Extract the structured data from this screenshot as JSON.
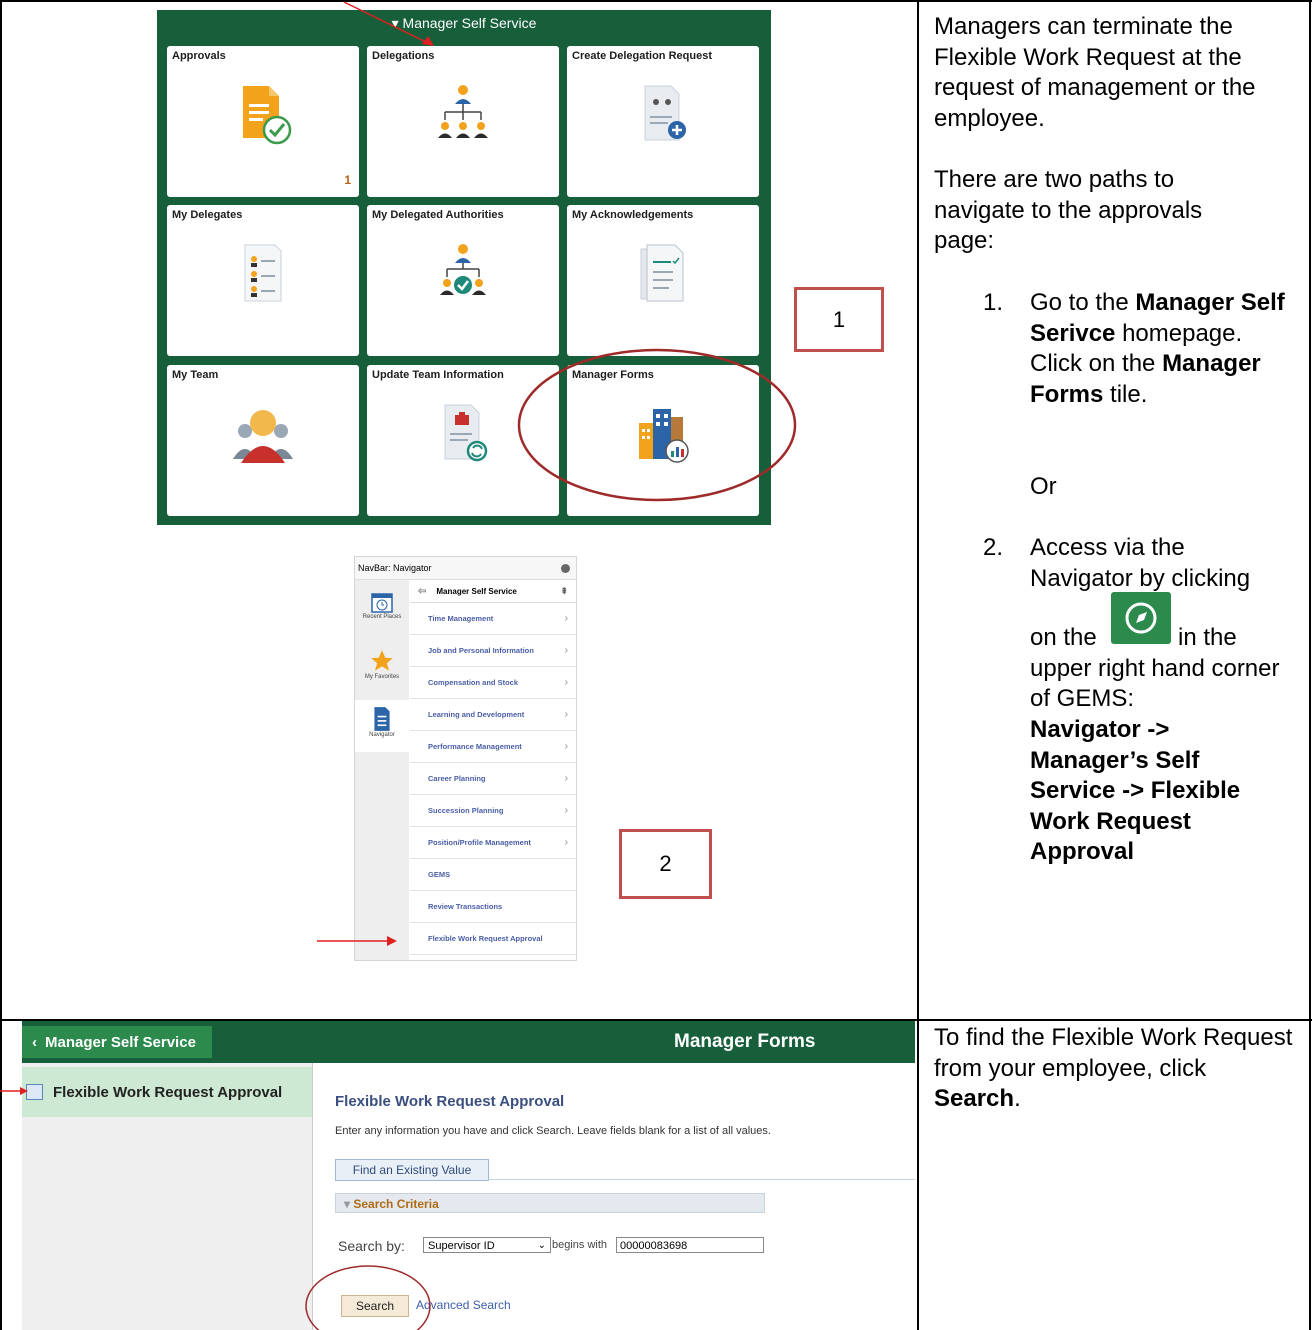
{
  "tiles_section": {
    "header": "▾ Manager Self Service",
    "tiles": [
      {
        "title": "Approvals",
        "icon": "approvals-document-check-icon",
        "count": "1"
      },
      {
        "title": "Delegations",
        "icon": "org-chart-icon"
      },
      {
        "title": "Create Delegation Request",
        "icon": "document-add-user-icon"
      },
      {
        "title": "My Delegates",
        "icon": "delegates-list-icon"
      },
      {
        "title": "My Delegated Authorities",
        "icon": "delegated-authority-check-icon"
      },
      {
        "title": "My Acknowledgements",
        "icon": "acknowledgements-checklist-icon"
      },
      {
        "title": "My Team",
        "icon": "team-person-icon"
      },
      {
        "title": "Update Team Information",
        "icon": "document-briefcase-refresh-icon"
      },
      {
        "title": "Manager Forms",
        "icon": "buildings-chart-icon"
      }
    ]
  },
  "callouts": {
    "one": "1",
    "two": "2"
  },
  "navigator": {
    "header": "NavBar: Navigator",
    "side": [
      {
        "label": "Recent Places",
        "icon": "calendar-clock-icon"
      },
      {
        "label": "My Favorites",
        "icon": "star-icon"
      },
      {
        "label": "Navigator",
        "icon": "navigator-document-icon"
      }
    ],
    "section": "Manager Self Service",
    "items": [
      {
        "label": "Time Management",
        "chevron": true
      },
      {
        "label": "Job and Personal Information",
        "chevron": true
      },
      {
        "label": "Compensation and Stock",
        "chevron": true
      },
      {
        "label": "Learning and Development",
        "chevron": true
      },
      {
        "label": "Performance Management",
        "chevron": true
      },
      {
        "label": "Career Planning",
        "chevron": true
      },
      {
        "label": "Succession Planning",
        "chevron": true
      },
      {
        "label": "Position/Profile Management",
        "chevron": true
      },
      {
        "label": "GEMS",
        "chevron": false
      },
      {
        "label": "Review Transactions",
        "chevron": false
      },
      {
        "label": "Flexible Work Request Approval",
        "chevron": false
      }
    ]
  },
  "right_text": {
    "p1": "Managers can terminate the Flexible Work Request at the request of management or the employee.",
    "p2": "There are two paths to navigate to the approvals page:",
    "s1_num": "1.",
    "s1_a": "Go to the ",
    "s1_b": "Manager Self Serivce",
    "s1_c": " homepage. Click on the ",
    "s1_d": "Manager Forms",
    "s1_e": " tile.",
    "or": "Or",
    "s2_num": "2.",
    "s2_a": "Access via the Navigator by clicking",
    "s2_b": "on the",
    "s2_c": "in the upper right hand corner of GEMS:",
    "s2_path": "Navigator -> Manager’s Self Service -> Flexible Work Request Approval",
    "p3_a": "To find the Flexible Work Request from your employee, click ",
    "p3_b": "Search",
    "p3_c": "."
  },
  "manager_forms": {
    "back_label": "Manager Self Service",
    "title": "Manager Forms",
    "side_item": "Flexible Work Request Approval",
    "page_title": "Flexible Work Request Approval",
    "instructions": "Enter any information you have and click Search. Leave fields blank for a list of all values.",
    "tab": "Find an Existing Value",
    "criteria": "Search Criteria",
    "search_by_label": "Search by:",
    "search_by_value": "Supervisor ID",
    "begins_with": "begins with",
    "input_value": "00000083698",
    "search_button": "Search",
    "advanced_search": "Advanced Search"
  }
}
